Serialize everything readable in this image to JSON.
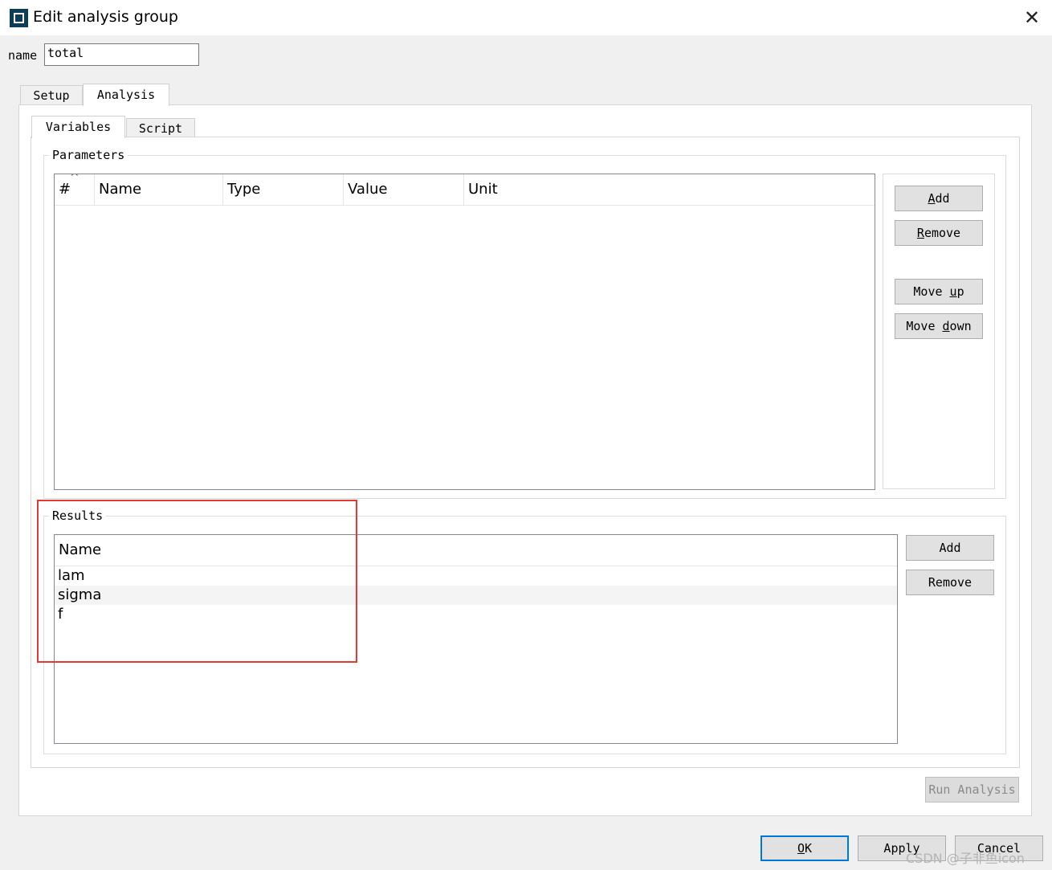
{
  "window": {
    "title": "Edit analysis group",
    "close_glyph": "✕"
  },
  "name_field": {
    "label": "name",
    "value": "total"
  },
  "main_tabs": [
    {
      "label": "Setup",
      "active": false
    },
    {
      "label": "Analysis",
      "active": true
    }
  ],
  "sub_tabs": [
    {
      "label": "Variables",
      "active": true
    },
    {
      "label": "Script",
      "active": false
    }
  ],
  "parameters": {
    "title": "Parameters",
    "sort_glyph": "^",
    "columns": [
      "#",
      "Name",
      "Type",
      "Value",
      "Unit"
    ],
    "rows": [],
    "buttons": {
      "add": "Add",
      "remove": "Remove",
      "move_up": "Move up",
      "move_down": "Move down"
    }
  },
  "results": {
    "title": "Results",
    "columns": [
      "Name"
    ],
    "rows": [
      "lam",
      "sigma",
      "f"
    ],
    "buttons": {
      "add": "Add",
      "remove": "Remove"
    }
  },
  "run_analysis_label": "Run Analysis",
  "footer": {
    "ok": "OK",
    "apply": "Apply",
    "cancel": "Cancel"
  },
  "watermark": "CSDN @子非鱼icon",
  "colors": {
    "app_icon": "#0c3e5a",
    "highlight": "#e53935",
    "default_button_border": "#0078d7"
  },
  "icons": {
    "app": "app-icon",
    "close": "close-icon",
    "sort": "sort-ascending-icon"
  }
}
